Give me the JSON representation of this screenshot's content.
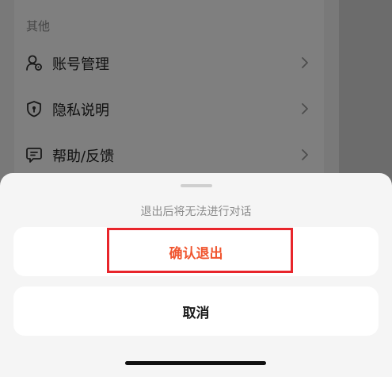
{
  "settings": {
    "section_title": "其他",
    "items": [
      {
        "label": "账号管理",
        "icon": "account-manage-icon"
      },
      {
        "label": "隐私说明",
        "icon": "privacy-shield-icon"
      },
      {
        "label": "帮助/反馈",
        "icon": "help-feedback-icon"
      }
    ]
  },
  "sheet": {
    "message": "退出后将无法进行对话",
    "confirm_label": "确认退出",
    "cancel_label": "取消"
  },
  "colors": {
    "confirm_text": "#f0552f",
    "highlight_border": "#e8252b"
  }
}
